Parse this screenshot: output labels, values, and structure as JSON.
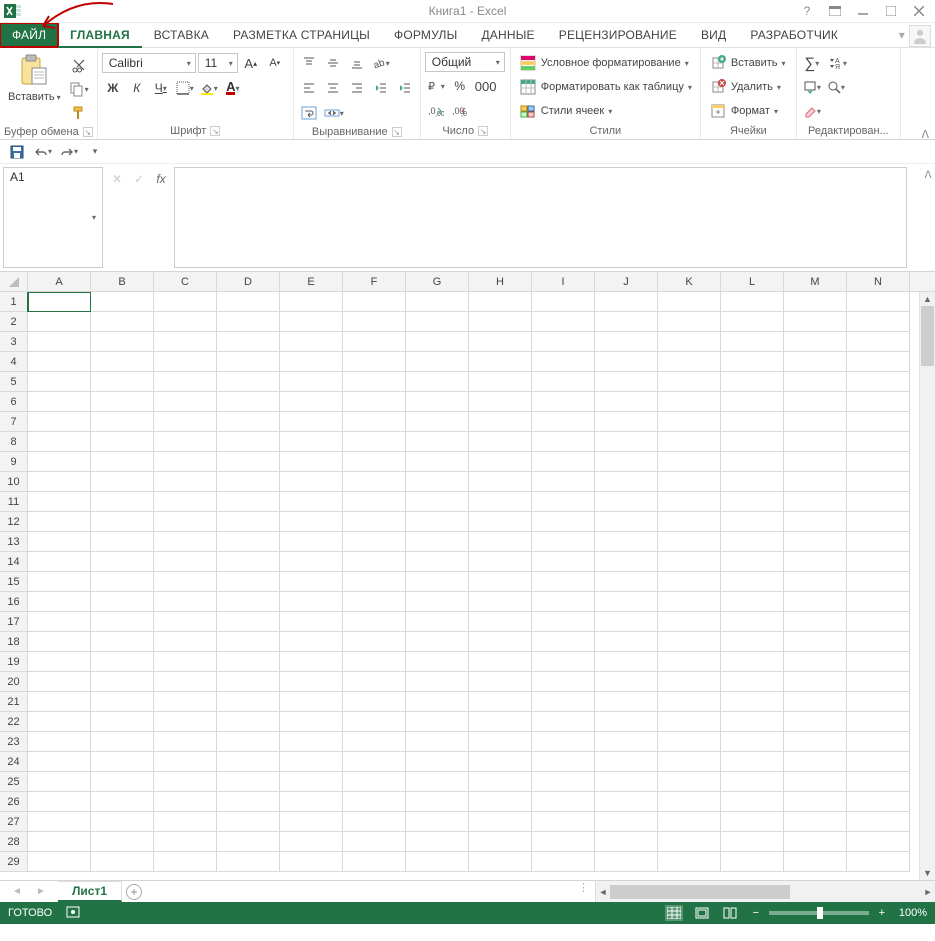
{
  "title": "Книга1 - Excel",
  "tabs": {
    "file": "ФАЙЛ",
    "home": "ГЛАВНАЯ",
    "insert": "ВСТАВКА",
    "pagelayout": "РАЗМЕТКА СТРАНИЦЫ",
    "formulas": "ФОРМУЛЫ",
    "data": "ДАННЫЕ",
    "review": "РЕЦЕНЗИРОВАНИЕ",
    "view": "ВИД",
    "developer": "РАЗРАБОТЧИК"
  },
  "ribbon": {
    "clipboard": {
      "paste": "Вставить",
      "label": "Буфер обмена"
    },
    "font": {
      "name": "Calibri",
      "size": "11",
      "label": "Шрифт",
      "bold": "Ж",
      "italic": "К",
      "underline": "Ч"
    },
    "align": {
      "label": "Выравнивание"
    },
    "number": {
      "format": "Общий",
      "label": "Число"
    },
    "styles": {
      "cond": "Условное форматирование",
      "table": "Форматировать как таблицу",
      "cells": "Стили ячеек",
      "label": "Стили"
    },
    "cells": {
      "insert": "Вставить",
      "delete": "Удалить",
      "format": "Формат",
      "label": "Ячейки"
    },
    "editing": {
      "label": "Редактирован..."
    }
  },
  "namebox": "A1",
  "fx_label": "fx",
  "columns": [
    "A",
    "B",
    "C",
    "D",
    "E",
    "F",
    "G",
    "H",
    "I",
    "J",
    "K",
    "L",
    "M",
    "N"
  ],
  "rows": [
    1,
    2,
    3,
    4,
    5,
    6,
    7,
    8,
    9,
    10,
    11,
    12,
    13,
    14,
    15,
    16,
    17,
    18,
    19,
    20,
    21,
    22,
    23,
    24,
    25,
    26,
    27,
    28,
    29
  ],
  "sheet": "Лист1",
  "status": "ГОТОВО",
  "zoom": "100%"
}
